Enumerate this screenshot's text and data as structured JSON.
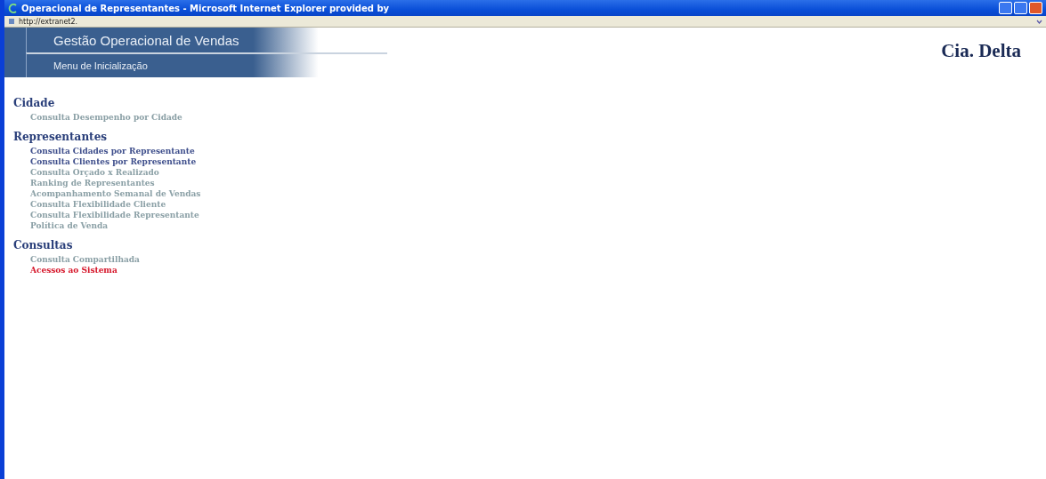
{
  "window": {
    "title": "Operacional de Representantes - Microsoft Internet Explorer provided by"
  },
  "address_bar": {
    "url": "http://extranet2."
  },
  "banner": {
    "title": "Gestão Operacional de Vendas",
    "subtitle": "Menu de Inicialização"
  },
  "company": "Cia. Delta",
  "sections": [
    {
      "heading": "Cidade",
      "links": [
        {
          "label": "Consulta Desempenho por Cidade",
          "kind": "plain"
        }
      ]
    },
    {
      "heading": "Representantes",
      "links": [
        {
          "label": "Consulta Cidades por Representante",
          "kind": "visited"
        },
        {
          "label": "Consulta Clientes por Representante",
          "kind": "visited"
        },
        {
          "label": "Consulta Orçado x Realizado",
          "kind": "plain"
        },
        {
          "label": "Ranking de Representantes",
          "kind": "plain"
        },
        {
          "label": "Acompanhamento Semanal de Vendas",
          "kind": "plain"
        },
        {
          "label": "Consulta Flexibilidade Cliente",
          "kind": "plain"
        },
        {
          "label": "Consulta Flexibilidade Representante",
          "kind": "plain"
        },
        {
          "label": "Política de Venda",
          "kind": "plain"
        }
      ]
    },
    {
      "heading": "Consultas",
      "links": [
        {
          "label": "Consulta Compartilhada",
          "kind": "plain"
        },
        {
          "label": "Acessos ao Sistema",
          "kind": "active"
        }
      ]
    }
  ]
}
